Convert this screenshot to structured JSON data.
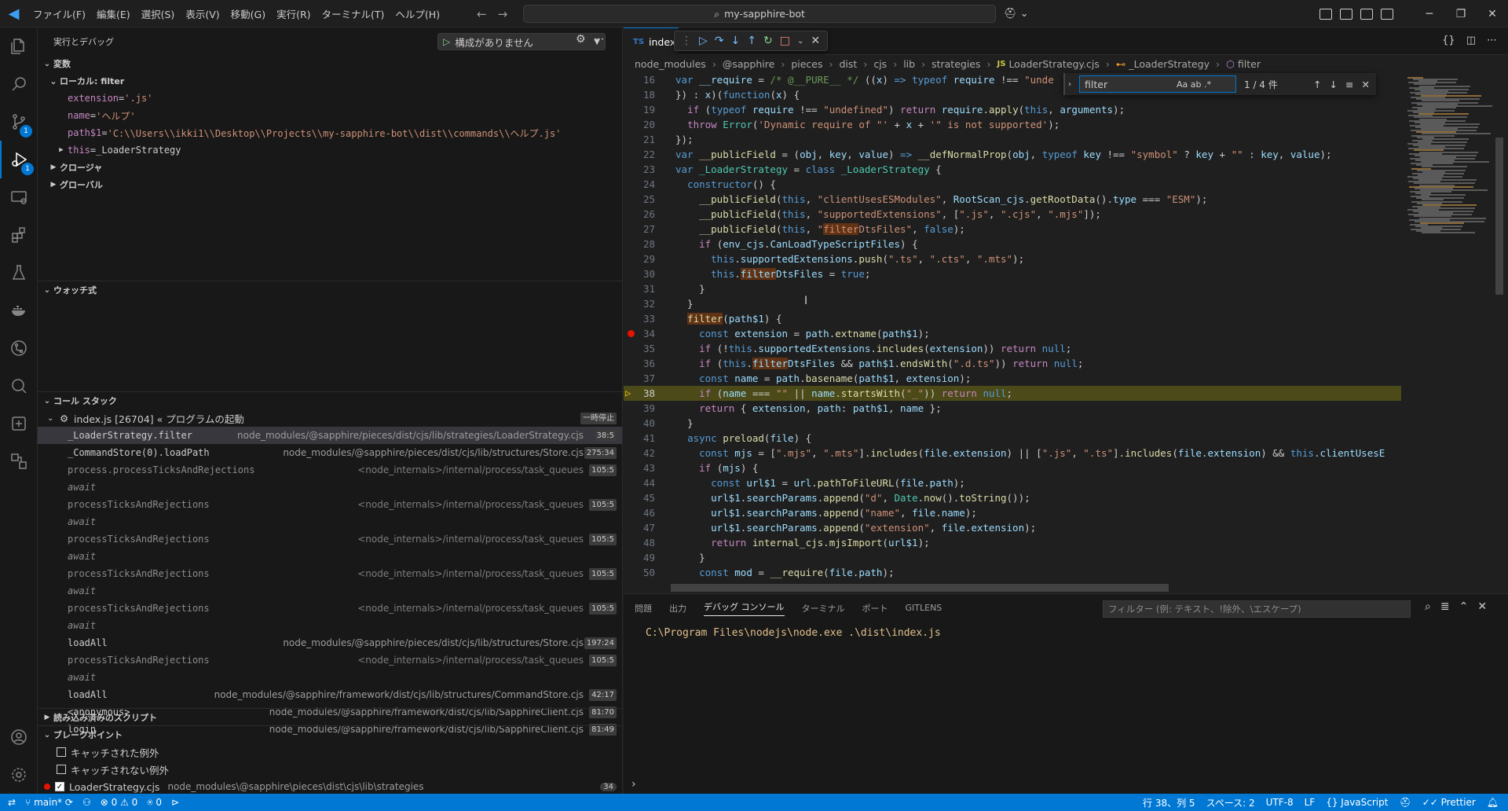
{
  "titlebar": {
    "menu": [
      "ファイル(F)",
      "編集(E)",
      "選択(S)",
      "表示(V)",
      "移動(G)",
      "実行(R)",
      "ターミナル(T)",
      "ヘルプ(H)"
    ],
    "search": "my-sapphire-bot"
  },
  "sidebar": {
    "title": "実行とデバッグ",
    "run_config": "構成がありません",
    "variables": {
      "header": "変数",
      "local_header": "ローカル: filter",
      "items": [
        {
          "name": "extension",
          "eq": " = ",
          "value": "'.js'"
        },
        {
          "name": "name",
          "eq": " = ",
          "value": "'ヘルプ'"
        },
        {
          "name": "path$1",
          "eq": " = ",
          "value": "'C:\\\\Users\\\\ikki1\\\\Desktop\\\\Projects\\\\my-sapphire-bot\\\\dist\\\\commands\\\\ヘルプ.js'"
        },
        {
          "name": "this",
          "eq": " = ",
          "value": "_LoaderStrategy"
        }
      ],
      "closure": "クロージャ",
      "global": "グローバル"
    },
    "watch": {
      "header": "ウォッチ式"
    },
    "callstack": {
      "header": "コール スタック",
      "thread": "index.js [26704] « プログラムの起動",
      "thread_status": "一時停止",
      "frames": [
        {
          "fn": "_LoaderStrategy.filter",
          "path": "node_modules/@sapphire/pieces/dist/cjs/lib/strategies/LoaderStrategy.cjs",
          "ln": "38:5",
          "kind": "sel"
        },
        {
          "fn": "_CommandStore(0).loadPath",
          "path": "node_modules/@sapphire/pieces/dist/cjs/lib/structures/Store.cjs",
          "ln": "275:34",
          "kind": ""
        },
        {
          "fn": "process.processTicksAndRejections",
          "path": "<node_internals>/internal/process/task_queues",
          "ln": "105:5",
          "kind": "internal"
        },
        {
          "fn": "await",
          "path": "",
          "ln": "",
          "kind": "await"
        },
        {
          "fn": "processTicksAndRejections",
          "path": "<node_internals>/internal/process/task_queues",
          "ln": "105:5",
          "kind": "internal"
        },
        {
          "fn": "await",
          "path": "",
          "ln": "",
          "kind": "await"
        },
        {
          "fn": "processTicksAndRejections",
          "path": "<node_internals>/internal/process/task_queues",
          "ln": "105:5",
          "kind": "internal"
        },
        {
          "fn": "await",
          "path": "",
          "ln": "",
          "kind": "await"
        },
        {
          "fn": "processTicksAndRejections",
          "path": "<node_internals>/internal/process/task_queues",
          "ln": "105:5",
          "kind": "internal"
        },
        {
          "fn": "await",
          "path": "",
          "ln": "",
          "kind": "await"
        },
        {
          "fn": "processTicksAndRejections",
          "path": "<node_internals>/internal/process/task_queues",
          "ln": "105:5",
          "kind": "internal"
        },
        {
          "fn": "await",
          "path": "",
          "ln": "",
          "kind": "await"
        },
        {
          "fn": "loadAll",
          "path": "node_modules/@sapphire/pieces/dist/cjs/lib/structures/Store.cjs",
          "ln": "197:24",
          "kind": ""
        },
        {
          "fn": "processTicksAndRejections",
          "path": "<node_internals>/internal/process/task_queues",
          "ln": "105:5",
          "kind": "internal"
        },
        {
          "fn": "await",
          "path": "",
          "ln": "",
          "kind": "await"
        },
        {
          "fn": "loadAll",
          "path": "node_modules/@sapphire/framework/dist/cjs/lib/structures/CommandStore.cjs",
          "ln": "42:17",
          "kind": ""
        },
        {
          "fn": "<anonymous>",
          "path": "node_modules/@sapphire/framework/dist/cjs/lib/SapphireClient.cjs",
          "ln": "81:70",
          "kind": ""
        },
        {
          "fn": "login",
          "path": "node_modules/@sapphire/framework/dist/cjs/lib/SapphireClient.cjs",
          "ln": "81:49",
          "kind": ""
        }
      ]
    },
    "loaded_scripts": "読み込み済みのスクリプト",
    "breakpoints": {
      "header": "ブレークポイント",
      "items": [
        {
          "label": "キャッチされた例外",
          "path": "",
          "ln": ""
        },
        {
          "label": "キャッチされない例外",
          "path": "",
          "ln": ""
        },
        {
          "label": "LoaderStrategy.cjs",
          "path": "node_modules\\@sapphire\\pieces\\dist\\cjs\\lib\\strategies",
          "ln": "34"
        }
      ]
    }
  },
  "editor": {
    "tab": "index.t",
    "tab_lang": "TS",
    "breadcrumbs": [
      "node_modules",
      "@sapphire",
      "pieces",
      "dist",
      "cjs",
      "lib",
      "strategies",
      "LoaderStrategy.cjs",
      "_LoaderStrategy",
      "filter"
    ],
    "find": {
      "query": "filter",
      "count": "1 / 4 件",
      "opts": "Aa ab .*"
    },
    "current_line": 38,
    "breakpoint_line": 34
  },
  "panel": {
    "tabs": [
      "問題",
      "出力",
      "デバッグ コンソール",
      "ターミナル",
      "ポート",
      "GITLENS"
    ],
    "active_tab": "デバッグ コンソール",
    "filter_placeholder": "フィルター (例: テキスト、!除外、\\エスケープ)",
    "console_line": "C:\\Program Files\\nodejs\\node.exe .\\dist\\index.js"
  },
  "statusbar": {
    "branch": "main*",
    "errors": "0",
    "warnings": "0",
    "ports": "0",
    "position": "行 38、列 5",
    "spaces": "スペース: 2",
    "encoding": "UTF-8",
    "eol": "LF",
    "language": "JavaScript",
    "prettier": "Prettier"
  },
  "colors": {
    "accent": "#0078d4",
    "current_line": "#4b4a18",
    "breakpoint": "#e51400"
  }
}
